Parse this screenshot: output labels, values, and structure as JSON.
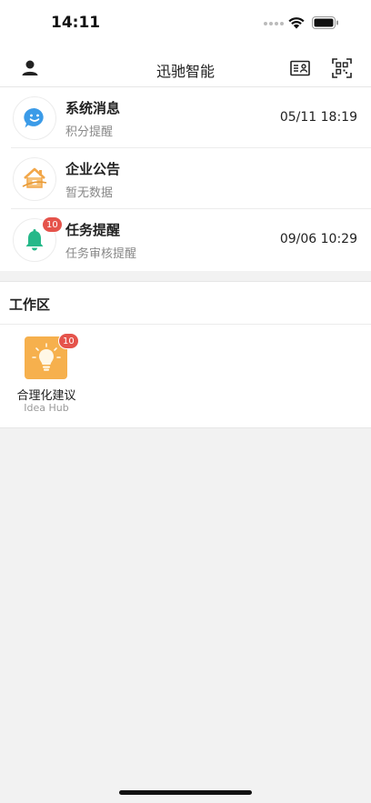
{
  "status_bar": {
    "time": "14:11"
  },
  "header": {
    "title": "迅驰智能",
    "icons": [
      "user-icon",
      "card-icon",
      "qr-scan-icon"
    ]
  },
  "messages": [
    {
      "title": "系统消息",
      "subtitle": "积分提醒",
      "time": "05/11 18:19",
      "badge": "",
      "icon": "chat-bubble-icon",
      "icon_color": "#3b9be8"
    },
    {
      "title": "企业公告",
      "subtitle": "暂无数据",
      "time": "",
      "badge": "",
      "icon": "house-icon",
      "icon_color": "#f2a74a"
    },
    {
      "title": "任务提醒",
      "subtitle": "任务审核提醒",
      "time": "09/06 10:29",
      "badge": "10",
      "icon": "bell-icon",
      "icon_color": "#25b889"
    }
  ],
  "workspace": {
    "title": "工作区",
    "apps": [
      {
        "name": "合理化建议",
        "subtitle": "Idea Hub",
        "badge": "10",
        "icon": "lightbulb-icon",
        "color": "#f6b04d"
      }
    ]
  },
  "colors": {
    "badge": "#e5534b",
    "background": "#f2f2f2"
  }
}
